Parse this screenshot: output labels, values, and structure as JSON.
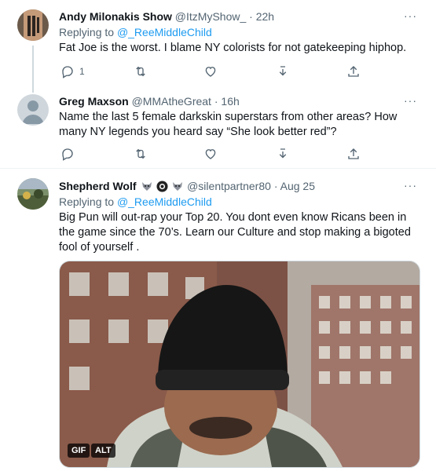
{
  "tweets": [
    {
      "name": "Andy Milonakis Show",
      "handle": "@ItzMyShow_",
      "time": "22h",
      "replying_label": "Replying to",
      "replying_to": "@_ReeMiddleChild",
      "text": "Fat Joe is the worst. I blame NY colorists for not gatekeeping hiphop.",
      "reply_count": "1"
    },
    {
      "name": "Greg Maxson",
      "handle": "@MMAtheGreat",
      "time": "16h",
      "text": "Name the last 5 female darkskin superstars from other areas? How many NY legends you heard say “She look better red”?"
    },
    {
      "name": "Shepherd Wolf",
      "handle": "@silentpartner80",
      "time": "Aug 25",
      "replying_label": "Replying to",
      "replying_to": "@_ReeMiddleChild",
      "text": "Big Pun will out-rap your Top 20. You dont even know Ricans been in the game since the 70’s. Learn our Culture and stop making a bigoted fool of yourself .",
      "media_badges": {
        "gif": "GIF",
        "alt": "ALT"
      }
    }
  ],
  "separator": "·",
  "more": "···",
  "colors": {
    "link": "#1d9bf0",
    "muted": "#536471",
    "text": "#0f1419",
    "divider": "#eff3f4"
  }
}
